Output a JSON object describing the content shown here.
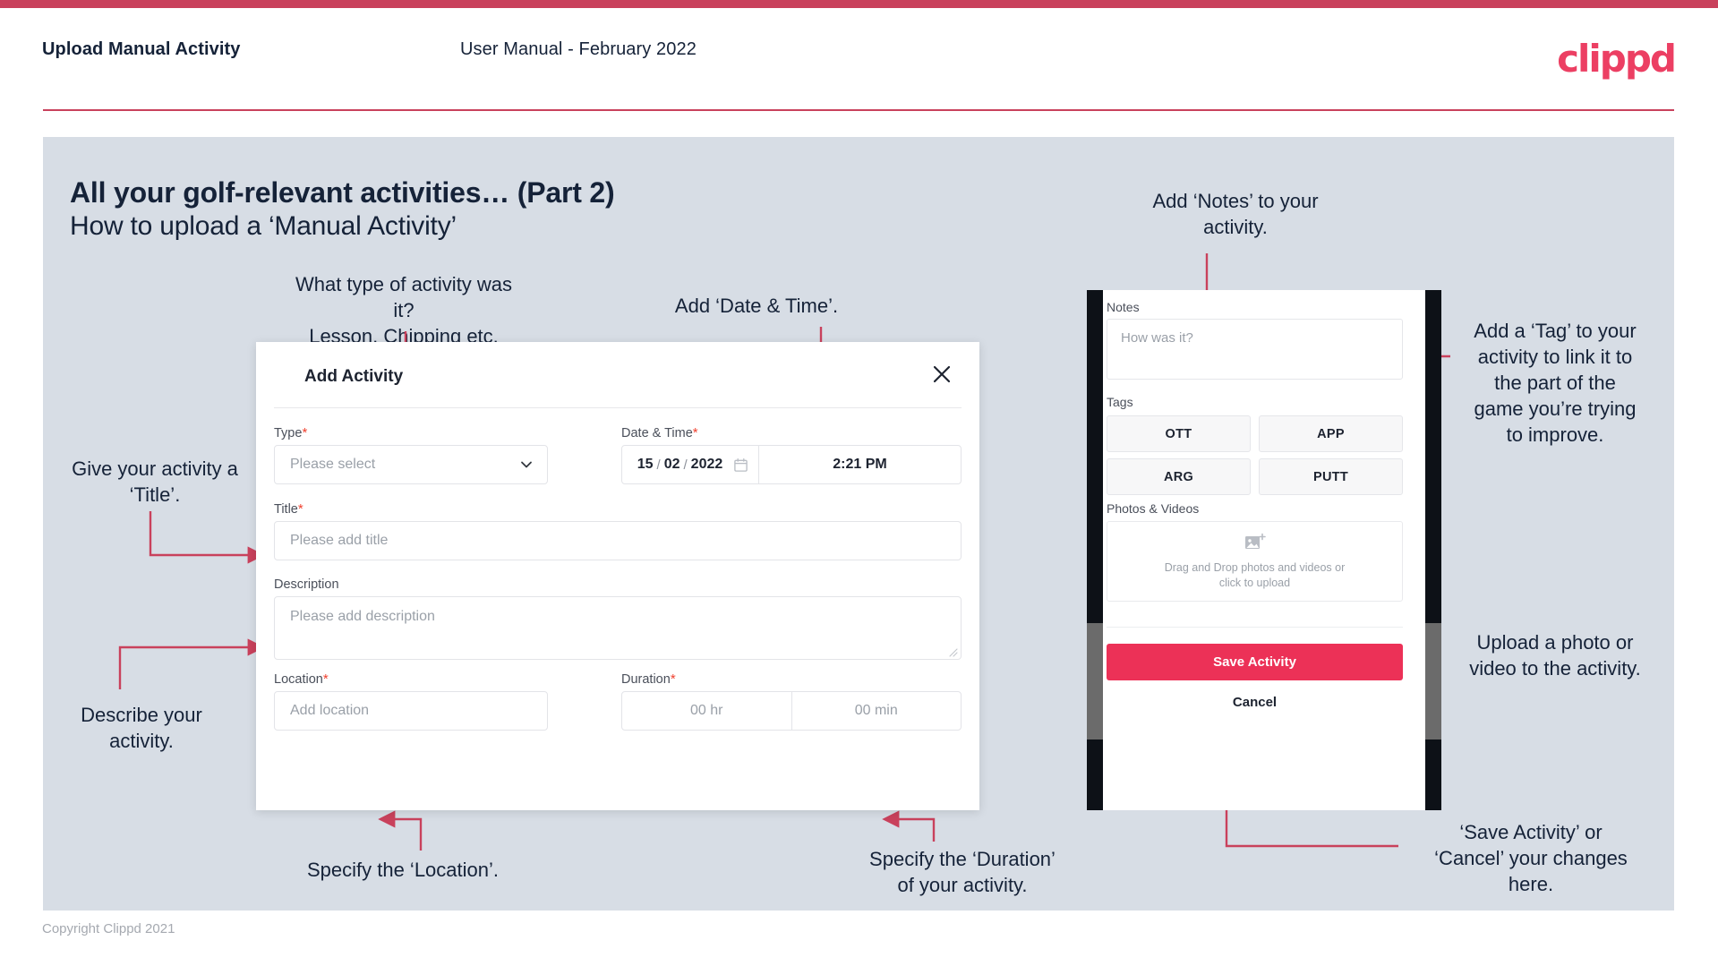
{
  "header": {
    "title": "Upload Manual Activity",
    "subtitle": "User Manual - February 2022",
    "logo": "clippd"
  },
  "slide": {
    "heading": "All your golf-relevant activities… (Part 2)",
    "subheading": "How to upload a ‘Manual Activity’"
  },
  "annotations": {
    "type": "What type of activity was it?\nLesson, Chipping etc.",
    "datetime": "Add ‘Date & Time’.",
    "title": "Give your activity a\n‘Title’.",
    "description": "Describe your\nactivity.",
    "location": "Specify the ‘Location’.",
    "duration": "Specify the ‘Duration’\nof your activity.",
    "notes": "Add ‘Notes’ to your\nactivity.",
    "tags": "Add a ‘Tag’ to your\nactivity to link it to\nthe part of the\ngame you’re trying\nto improve.",
    "upload": "Upload a photo or\nvideo to the activity.",
    "save": "‘Save Activity’ or\n‘Cancel’ your changes\nhere."
  },
  "dialog": {
    "title": "Add Activity",
    "close_icon": "close-icon",
    "fields": {
      "type": {
        "label": "Type",
        "required": "*",
        "placeholder": "Please select"
      },
      "datetime": {
        "label": "Date & Time",
        "required": "*",
        "day": "15",
        "month": "02",
        "year": "2022",
        "sep1": "/",
        "sep2": "/",
        "time": "2:21 PM"
      },
      "title": {
        "label": "Title",
        "required": "*",
        "placeholder": "Please add title"
      },
      "description": {
        "label": "Description",
        "required": "",
        "placeholder": "Please add description"
      },
      "location": {
        "label": "Location",
        "required": "*",
        "placeholder": "Add location"
      },
      "duration": {
        "label": "Duration",
        "required": "*",
        "hours": "00 hr",
        "minutes": "00 min"
      }
    }
  },
  "phone": {
    "notes": {
      "label": "Notes",
      "placeholder": "How was it?"
    },
    "tags": {
      "label": "Tags",
      "items": [
        "OTT",
        "APP",
        "ARG",
        "PUTT"
      ]
    },
    "photos": {
      "label": "Photos & Videos",
      "drop_text": "Drag and Drop photos and videos or\nclick to upload"
    },
    "save_label": "Save Activity",
    "cancel_label": "Cancel"
  },
  "footer": {
    "copyright": "Copyright Clippd 2021"
  },
  "colors": {
    "brand": "#ec3f63",
    "accent_bar": "#c9415c",
    "slide_bg": "#d7dde5",
    "text_dark": "#152238",
    "save_button": "#ec3157",
    "annotation_line": "#c9415c"
  }
}
